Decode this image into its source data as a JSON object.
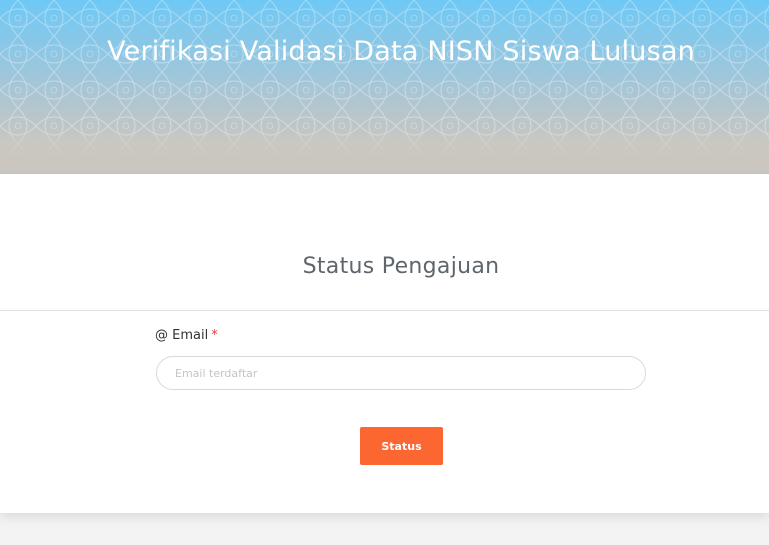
{
  "header": {
    "title": "Verifikasi Validasi Data NISN Siswa Lulusan"
  },
  "form": {
    "section_title": "Status Pengajuan",
    "email_label": "@ Email",
    "required_marker": "*",
    "email_placeholder": "Email terdaftar",
    "email_value": "",
    "submit_label": "Status"
  },
  "colors": {
    "accent": "#fc6631",
    "header_top": "#6ec8f5",
    "header_bottom": "#cbc7c0",
    "required": "#e53935"
  }
}
